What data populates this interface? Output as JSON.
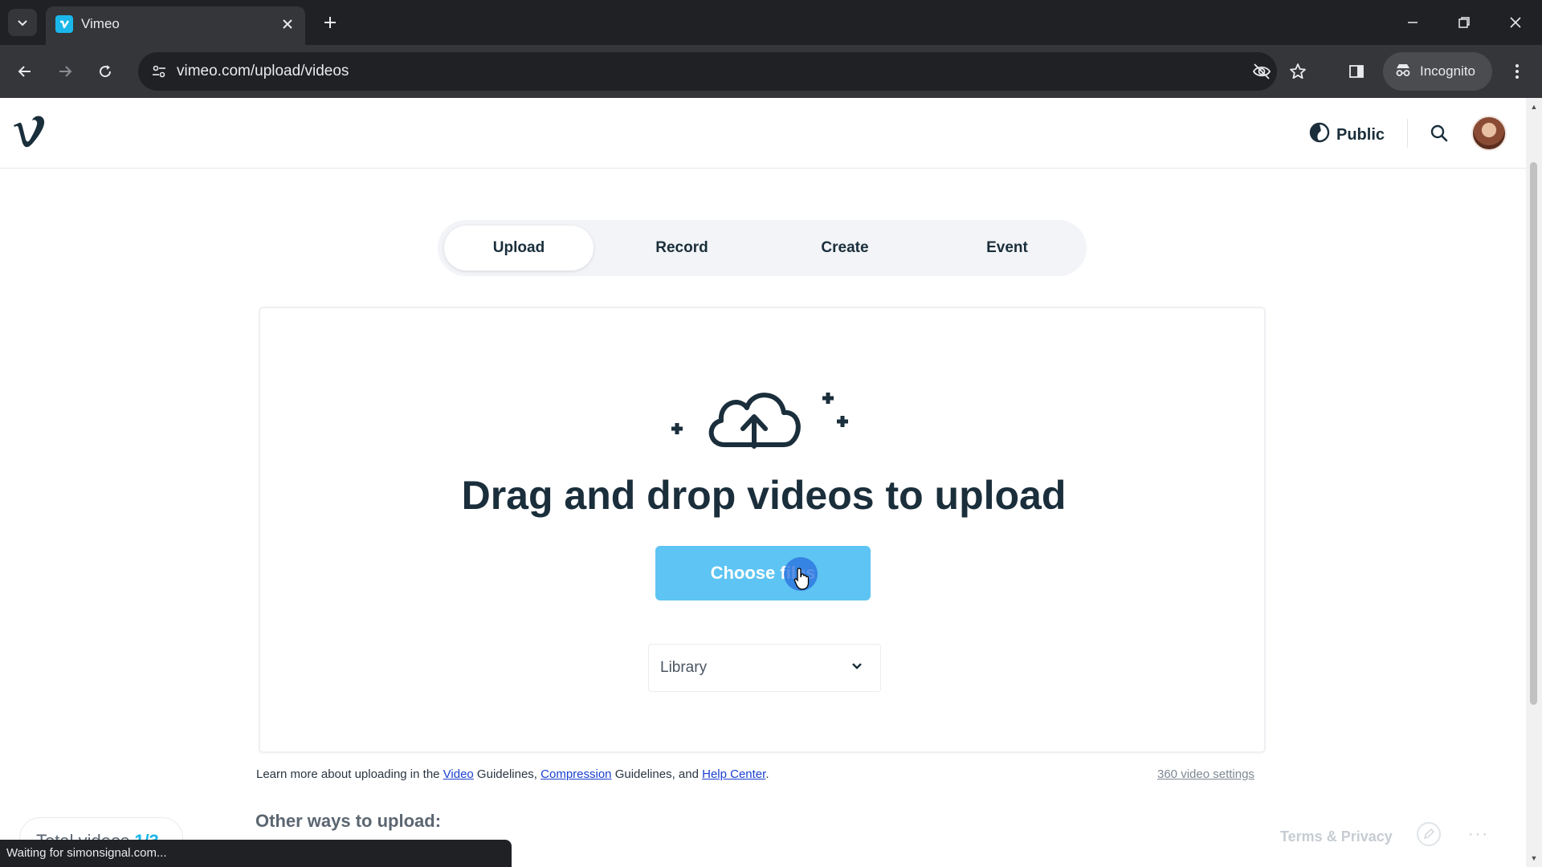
{
  "browser": {
    "tab_title": "Vimeo",
    "url": "vimeo.com/upload/videos",
    "incognito_label": "Incognito",
    "icons": [
      "tab-search-icon",
      "vimeo-favicon-icon",
      "close-icon",
      "plus-icon",
      "minimize-icon",
      "restore-icon",
      "close-window-icon",
      "back-icon",
      "forward-icon",
      "reload-icon",
      "site-info-icon",
      "eye-off-icon",
      "star-icon",
      "side-panel-icon",
      "incognito-icon",
      "more-vert-icon"
    ]
  },
  "header": {
    "privacy_label": "Public"
  },
  "tabs": [
    {
      "label": "Upload",
      "active": true
    },
    {
      "label": "Record",
      "active": false
    },
    {
      "label": "Create",
      "active": false
    },
    {
      "label": "Event",
      "active": false
    }
  ],
  "upload": {
    "title": "Drag and drop videos to upload",
    "choose_button": "Choose files",
    "folder_select": "Library"
  },
  "guidelines": {
    "prefix": "Learn more about uploading in the ",
    "video_link": "Video",
    "mid1": " Guidelines, ",
    "compression_link": "Compression",
    "mid2": " Guidelines, and ",
    "help_link": "Help Center",
    "suffix": "."
  },
  "video_360_settings": "360 video settings",
  "other_ways": "Other ways to upload:",
  "footer": {
    "total_videos_label": "Total videos",
    "total_videos_count": "1/3",
    "terms": "Terms & Privacy",
    "more": "···"
  },
  "status_text": "Waiting for simonsignal.com...",
  "colors": {
    "accent": "#1ab7ea",
    "button": "#5ec4f3",
    "text_dark": "#1a2e3b",
    "link": "#1a3fd0"
  }
}
